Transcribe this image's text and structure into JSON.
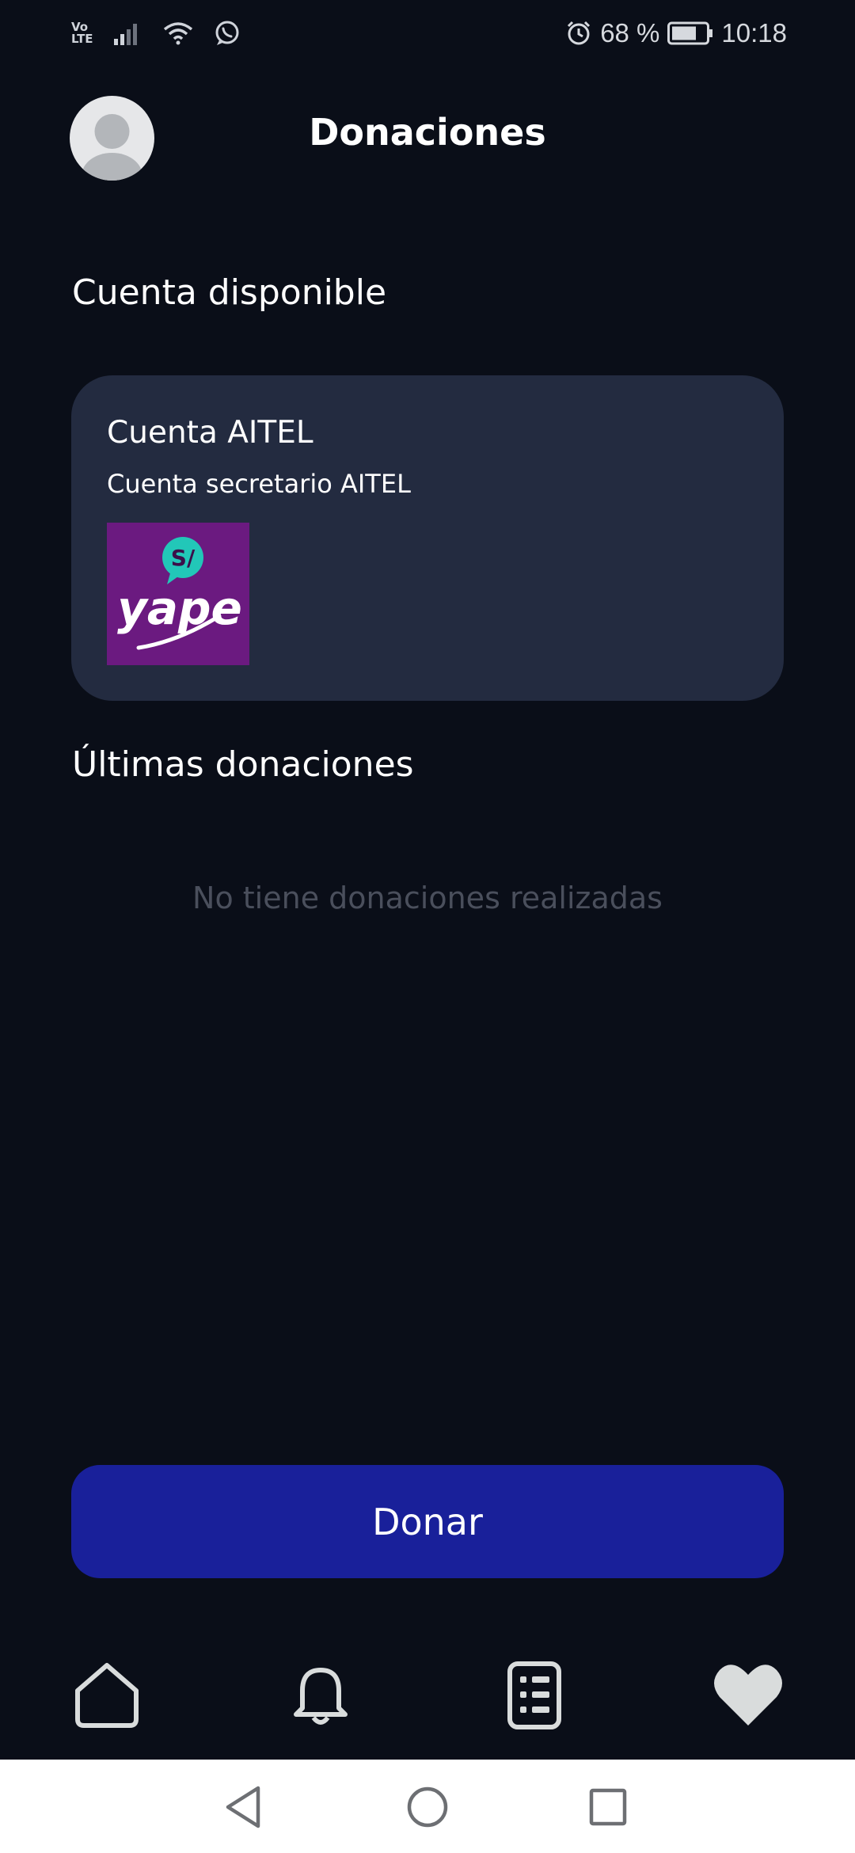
{
  "status_bar": {
    "network_label": "Vo\nLTE",
    "battery_percent": "68 %",
    "time": "10:18"
  },
  "header": {
    "title": "Donaciones"
  },
  "available_account": {
    "section_title": "Cuenta disponible",
    "card": {
      "name": "Cuenta AITEL",
      "description": "Cuenta secretario AITEL",
      "logo": {
        "text": "yape",
        "badge": "S/",
        "background": "#6b1a80",
        "badge_color": "#22c7b8"
      }
    }
  },
  "recent_donations": {
    "section_title": "Últimas donaciones",
    "empty_message": "No tiene donaciones realizadas"
  },
  "actions": {
    "donate_label": "Donar"
  },
  "bottom_nav": {
    "items": [
      {
        "icon": "home-icon",
        "active": false
      },
      {
        "icon": "bell-icon",
        "active": false
      },
      {
        "icon": "list-icon",
        "active": false
      },
      {
        "icon": "heart-icon",
        "active": true
      }
    ]
  },
  "colors": {
    "background": "#0a0e18",
    "card": "#232b40",
    "primary_button": "#19209a",
    "muted_text": "#4a4f5c"
  }
}
